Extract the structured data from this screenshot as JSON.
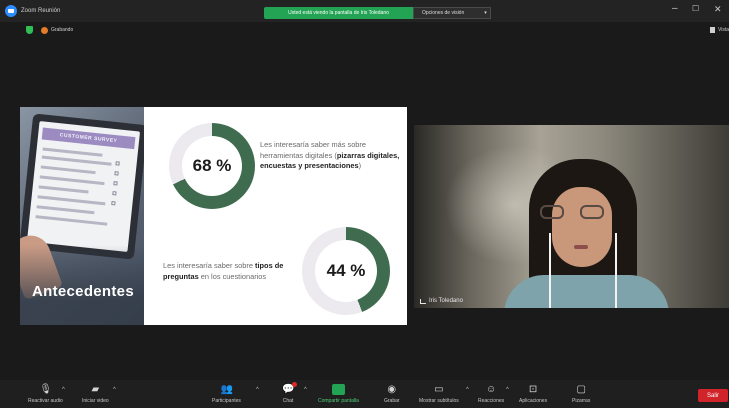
{
  "window": {
    "title": "Zoom Reunión",
    "share_banner": "Usted está viendo la pantalla de Iris Toledano",
    "view_options": "Opciones de visión",
    "view_options_caret": "▾",
    "minimize": "–",
    "maximize": "☐",
    "close": "✕"
  },
  "recording": {
    "label": "Grabando"
  },
  "view": {
    "layout_label": "Vista"
  },
  "slide": {
    "photo_header": "CUSTOMER SURVEY",
    "photo_title": "Antecedentes",
    "stat1": {
      "percent_text": "68 %",
      "percent": 68,
      "text_pre": "Les interesaría saber más sobre herramientas digitales (",
      "text_bold": "pizarras digitales, encuestas y presentaciones",
      "text_post": ")"
    },
    "stat2": {
      "percent_text": "44 %",
      "percent": 44,
      "text_pre": "Les interesaría saber sobre ",
      "text_bold": "tipos de preguntas",
      "text_post": " en los cuestionarios"
    },
    "colors": {
      "ring_fill": "#3f6b4f",
      "ring_track": "#eceaef"
    }
  },
  "participant": {
    "name": "Iris Toledano"
  },
  "toolbar": {
    "items": [
      {
        "label": "Reactivar audio",
        "icon": "mic-off-icon"
      },
      {
        "label": "Iniciar video",
        "icon": "video-off-icon"
      },
      {
        "label": "Participantes",
        "icon": "participants-icon",
        "count": "2"
      },
      {
        "label": "Chat",
        "icon": "chat-icon"
      },
      {
        "label": "Compartir pantalla",
        "icon": "share-screen-icon"
      },
      {
        "label": "Grabar",
        "icon": "record-icon"
      },
      {
        "label": "Mostrar subtítulos",
        "icon": "captions-icon"
      },
      {
        "label": "Reacciones",
        "icon": "reactions-icon"
      },
      {
        "label": "Aplicaciones",
        "icon": "apps-icon"
      },
      {
        "label": "Pizarras",
        "icon": "whiteboard-icon"
      }
    ],
    "end_label": "Salir",
    "caret": "^"
  }
}
